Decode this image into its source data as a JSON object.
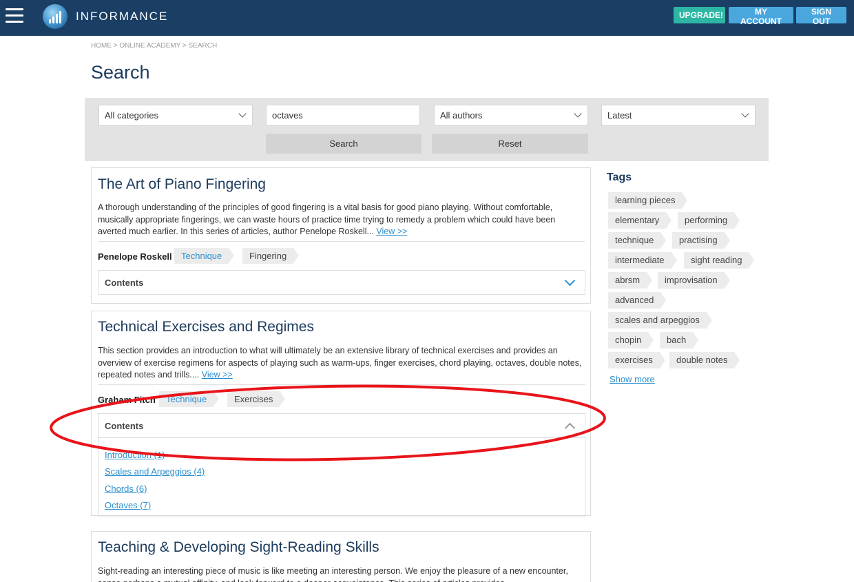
{
  "header": {
    "brand": "INFORMANCE",
    "upgrade_label": "UPGRADE!",
    "account_label": "MY ACCOUNT",
    "signout_label": "SIGN OUT",
    "colors": {
      "bar": "#1b3e64",
      "upgrade": "#2db6a4",
      "account": "#4aa7de"
    }
  },
  "breadcrumb": "HOME > ONLINE ACADEMY > SEARCH",
  "page_title": "Search",
  "filters": {
    "category": "All categories",
    "query": "octaves",
    "author": "All authors",
    "sort": "Latest",
    "search_label": "Search",
    "reset_label": "Reset"
  },
  "results": [
    {
      "title": "The Art of Piano Fingering",
      "description": "A thorough understanding of the principles of good fingering is a vital basis for good piano playing. Without comfortable, musically appropriate fingerings, we can waste hours of practice time trying to remedy a problem which could have been averted much earlier. In this series of articles, author Penelope Roskell...",
      "view_label": "View >>",
      "author": "Penelope Roskell",
      "tags": [
        "Technique",
        "Fingering"
      ],
      "contents_label": "Contents"
    },
    {
      "title": "Technical Exercises and Regimes",
      "description": "This section provides an introduction to what will ultimately be an extensive library of technical exercises and provides an overview of exercise regimens for aspects of playing such as warm-ups, finger exercises, chord playing, octaves, double notes, repeated notes and trills....",
      "view_label": "View >>",
      "author": "Graham Fitch",
      "tags": [
        "Technique",
        "Exercises"
      ],
      "contents_label": "Contents",
      "contents_items": [
        "Introduction (1)",
        "Scales and Arpeggios (4)",
        "Chords (6)",
        "Octaves (7)"
      ]
    },
    {
      "title": "Teaching & Developing Sight-Reading Skills",
      "description": "Sight-reading an interesting piece of music is like meeting an interesting person. We enjoy the pleasure of a new encounter, sense perhaps a mutual affinity, and look forward to a deeper acquaintance. This series of articles provides"
    }
  ],
  "sidebar": {
    "tags_heading": "Tags",
    "tags": [
      "learning pieces",
      "elementary",
      "performing",
      "technique",
      "practising",
      "intermediate",
      "sight reading",
      "abrsm",
      "improvisation",
      "advanced",
      "scales and arpeggios",
      "chopin",
      "bach",
      "exercises",
      "double notes"
    ],
    "show_more_label": "Show more"
  },
  "annotation_color": "#e8141a"
}
